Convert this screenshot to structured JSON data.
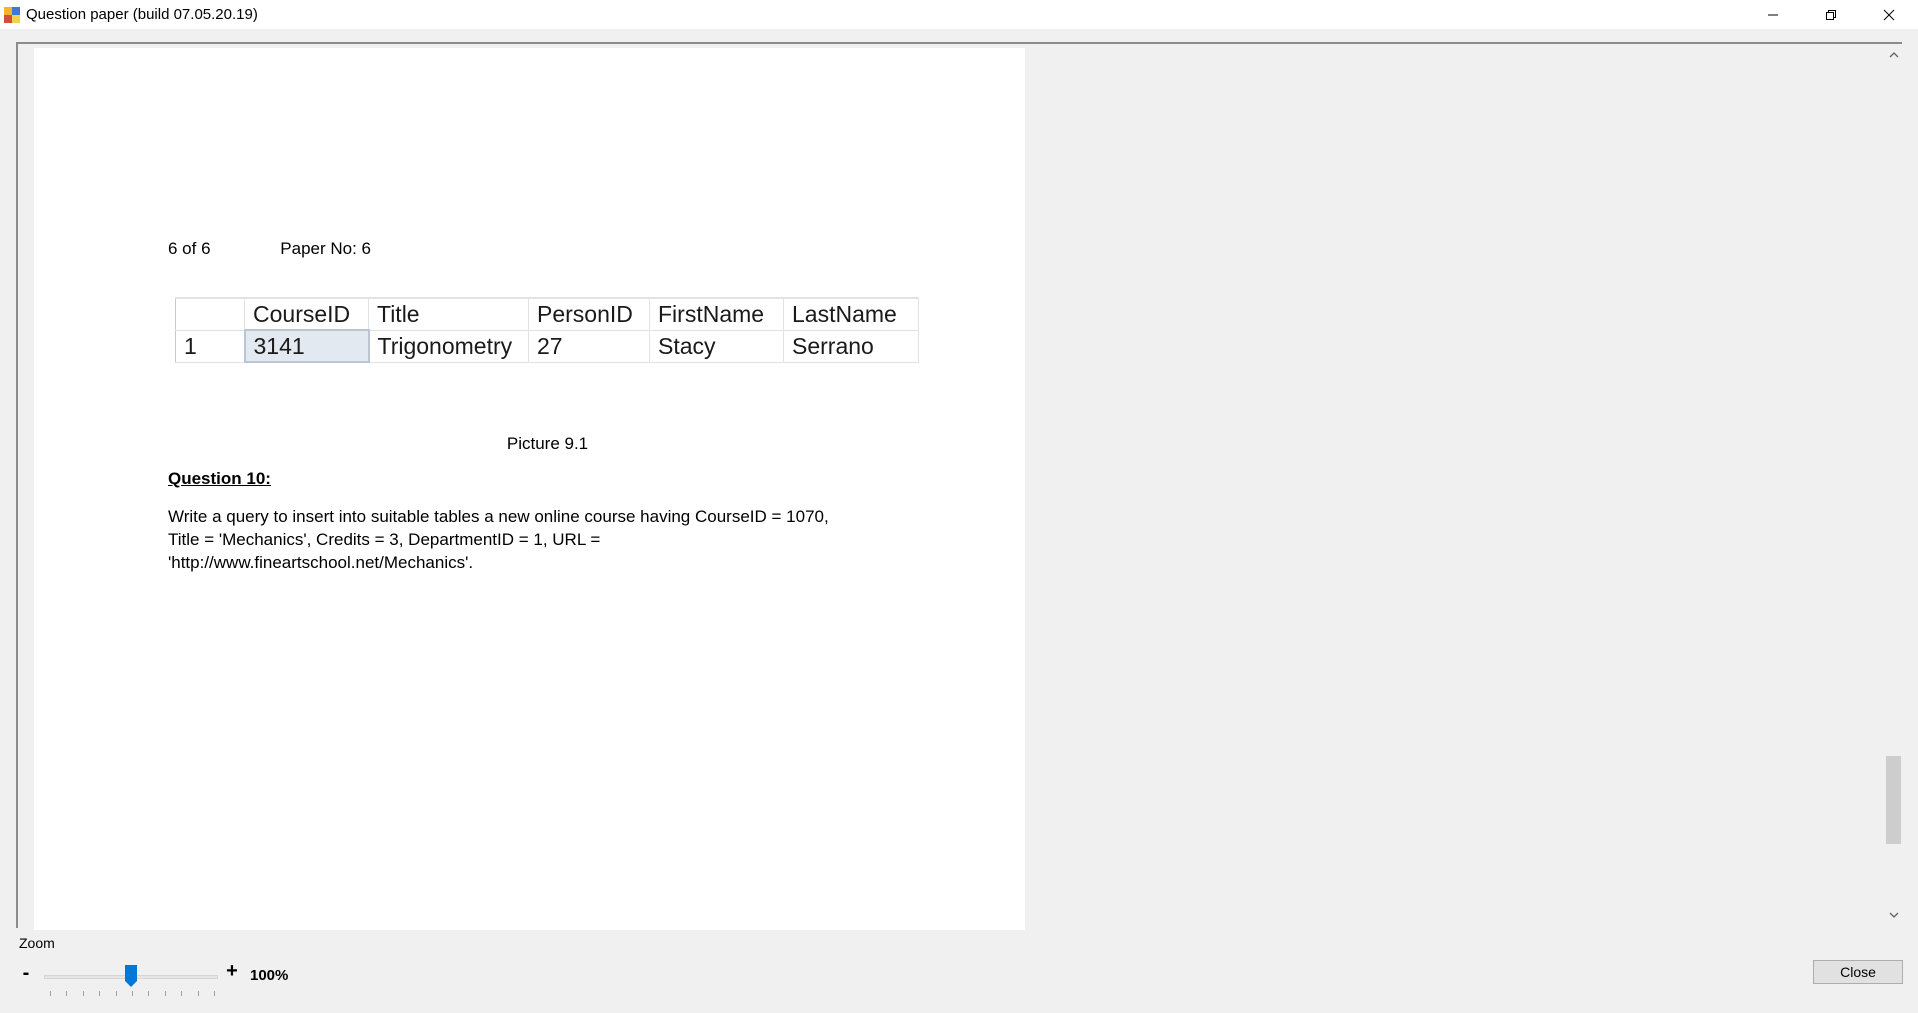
{
  "window": {
    "title": "Question paper (build 07.05.20.19)",
    "icon": "app-icon",
    "controls": [
      "minimize-icon",
      "restore-icon",
      "close-icon"
    ]
  },
  "page": {
    "position": "6 of 6",
    "paper_no": "Paper No: 6"
  },
  "picture": {
    "columns": [
      "",
      "CourseID",
      "Title",
      "PersonID",
      "FirstName",
      "LastName"
    ],
    "rows": [
      [
        "1",
        "3141",
        "Trigonometry",
        "27",
        "Stacy",
        "Serrano"
      ]
    ],
    "caption": "Picture 9.1"
  },
  "question": {
    "title": "Question 10:",
    "lines": [
      "Write a query to insert into suitable tables a new online course having CourseID = 1070,",
      "Title = 'Mechanics', Credits = 3, DepartmentID = 1, URL =",
      "'http://www.fineartschool.net/Mechanics'."
    ]
  },
  "zoom": {
    "label": "Zoom",
    "minus": "-",
    "plus": "+",
    "value": "100%",
    "level_fraction": 0.5
  },
  "buttons": {
    "close": "Close"
  },
  "colors": {
    "accent": "#0078d7",
    "selected_cell": "#e3e9f1"
  }
}
